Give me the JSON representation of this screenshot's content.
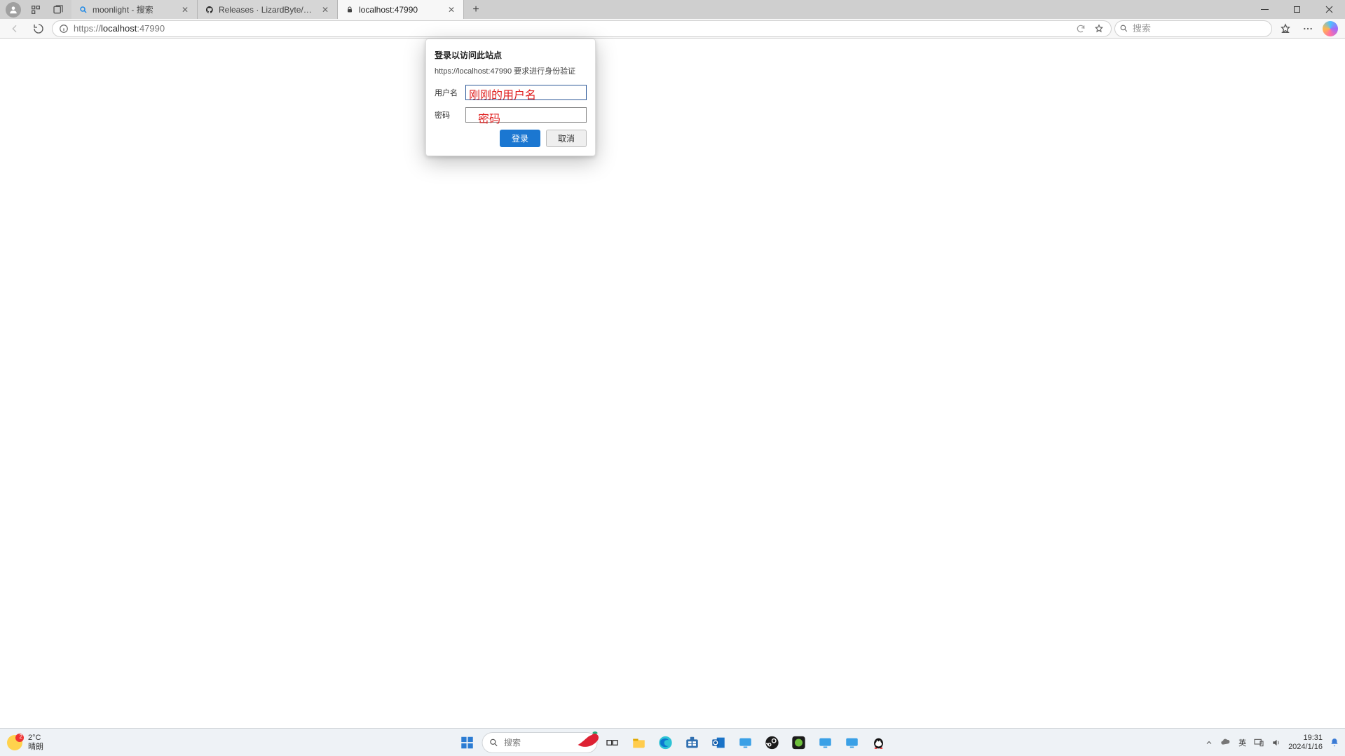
{
  "browser": {
    "tabs": [
      {
        "title": "moonlight - 搜索",
        "icon": "search"
      },
      {
        "title": "Releases · LizardByte/Sunshine",
        "icon": "github"
      },
      {
        "title": "localhost:47990",
        "icon": "lock"
      }
    ],
    "active_tab_index": 2,
    "address": {
      "scheme": "https://",
      "host": "localhost",
      "port": ":47990"
    },
    "search_placeholder": "搜索"
  },
  "dialog": {
    "title": "登录以访问此站点",
    "message": "https://localhost:47990 要求进行身份验证",
    "username_label": "用户名",
    "password_label": "密码",
    "username_value": "",
    "password_value": "",
    "login_button": "登录",
    "cancel_button": "取消"
  },
  "annotations": {
    "username_hint": "刚刚的用户名",
    "password_hint": "密码"
  },
  "taskbar": {
    "search_placeholder": "搜索",
    "weather_temp": "2°C",
    "weather_desc": "晴朗",
    "weather_badge": "2",
    "ime": "英",
    "clock_time": "19:31",
    "clock_date": "2024/1/16"
  }
}
